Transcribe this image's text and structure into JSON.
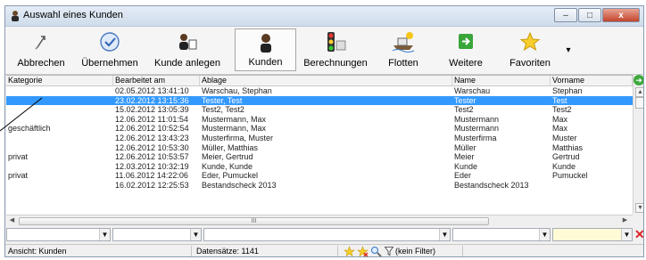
{
  "window": {
    "title": "Auswahl eines Kunden"
  },
  "caption": {
    "minimize": "–",
    "maximize": "□",
    "close": "x"
  },
  "toolbar": {
    "abbrechen": "Abbrechen",
    "uebernehmen": "Übernehmen",
    "kunde_anlegen": "Kunde anlegen",
    "kunden": "Kunden",
    "berechnungen": "Berechnungen",
    "flotten": "Flotten",
    "weitere": "Weitere",
    "favoriten": "Favoriten",
    "more": "▾"
  },
  "table": {
    "columns": [
      "Kategorie",
      "Bearbeitet am",
      "Ablage",
      "Name",
      "Vorname"
    ],
    "rows": [
      [
        "",
        "02.05.2012 13:41:10",
        "Warschau, Stephan",
        "Warschau",
        "Stephan"
      ],
      [
        "",
        "23.02.2012 13:15:36",
        "Tester, Test",
        "Tester",
        "Test"
      ],
      [
        "",
        "15.02.2012 13:05:39",
        "Test2, Test2",
        "Test2",
        "Test2"
      ],
      [
        "",
        "12.06.2012 11:01:54",
        "Mustermann, Max",
        "Mustermann",
        "Max"
      ],
      [
        "geschäftlich",
        "12.06.2012 10:52:54",
        "Mustermann, Max",
        "Mustermann",
        "Max"
      ],
      [
        "",
        "12.06.2012 13:43:23",
        "Musterfirma, Muster",
        "Musterfirma",
        "Muster"
      ],
      [
        "",
        "12.06.2012 10:53:30",
        "Müller, Matthias",
        "Müller",
        "Matthias"
      ],
      [
        "privat",
        "12.06.2012 10:53:57",
        "Meier, Gertrud",
        "Meier",
        "Gertrud"
      ],
      [
        "",
        "12.03.2012 10:32:19",
        "Kunde, Kunde",
        "Kunde",
        "Kunde"
      ],
      [
        "privat",
        "11.06.2012 14:22:06",
        "Eder, Pumuckel",
        "Eder",
        "Pumuckel"
      ],
      [
        "",
        "16.02.2012 12:25:53",
        "Bestandscheck 2013",
        "Bestandscheck 2013",
        ""
      ]
    ],
    "selected_row": 1
  },
  "hscroll": {
    "thumb_label": "III"
  },
  "status": {
    "view": "Ansicht: Kunden",
    "records": "Datensätze: 1141",
    "filter": "(kein Filter)"
  }
}
